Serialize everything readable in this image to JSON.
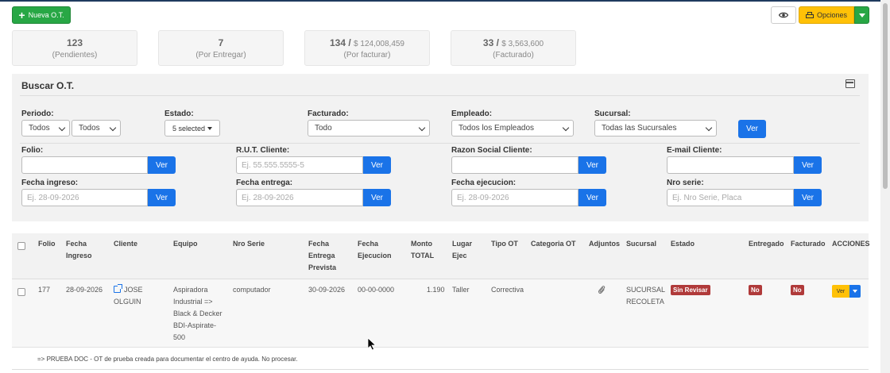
{
  "toolbar": {
    "new_label": "Nueva O.T.",
    "options_label": "Opciones"
  },
  "stats": [
    {
      "count": "123",
      "amount": "",
      "label": "(Pendientes)"
    },
    {
      "count": "7",
      "amount": "",
      "label": "(Por Entregar)"
    },
    {
      "count": "134 /",
      "amount": "$ 124,008,459",
      "label": "(Por facturar)"
    },
    {
      "count": "33 /",
      "amount": "$ 3,563,600",
      "label": "(Facturado)"
    }
  ],
  "search": {
    "title": "Buscar O.T.",
    "periodo_label": "Periodo:",
    "periodo_1": "Todos",
    "periodo_2": "Todos",
    "estado_label": "Estado:",
    "estado_value": "5 selected",
    "facturado_label": "Facturado:",
    "facturado_value": "Todo",
    "empleado_label": "Empleado:",
    "empleado_value": "Todos los Empleados",
    "sucursal_label": "Sucursal:",
    "sucursal_value": "Todas las Sucursales",
    "ver_label": "Ver",
    "folio_label": "Folio:",
    "rut_label": "R.U.T. Cliente:",
    "rut_placeholder": "Ej. 55.555.5555-5",
    "razon_label": "Razon Social Cliente:",
    "email_label": "E-mail Cliente:",
    "fecha_ingreso_label": "Fecha ingreso:",
    "fecha_ingreso_placeholder": "Ej. 28-09-2026",
    "fecha_entrega_label": "Fecha entrega:",
    "fecha_entrega_placeholder": "Ej. 28-09-2026",
    "fecha_ejecucion_label": "Fecha ejecucion:",
    "fecha_ejecucion_placeholder": "Ej. 28-09-2026",
    "nro_serie_label": "Nro serie:",
    "nro_serie_placeholder": "Ej. Nro Serie, Placa"
  },
  "table": {
    "headers": {
      "folio": "Folio",
      "fecha_ingreso": [
        "Fecha",
        "Ingreso"
      ],
      "cliente": "Cliente",
      "equipo": "Equipo",
      "nro_serie": "Nro Serie",
      "fecha_entrega": [
        "Fecha",
        "Entrega",
        "Prevista"
      ],
      "fecha_ejecucion": [
        "Fecha",
        "Ejecucion"
      ],
      "monto": [
        "Monto",
        "TOTAL"
      ],
      "lugar": [
        "Lugar",
        "Ejec"
      ],
      "tipo": "Tipo OT",
      "categoria": "Categoria OT",
      "adjuntos": "Adjuntos",
      "sucursal": "Sucursal",
      "estado": "Estado",
      "entregado": "Entregado",
      "facturado": "Facturado",
      "acciones": "ACCIONES"
    },
    "row": {
      "folio": "177",
      "fecha_ingreso": "28-09-2026",
      "cliente": [
        "JOSE",
        "OLGUIN"
      ],
      "equipo": [
        "Aspiradora",
        "Industrial =>",
        "Black & Decker",
        "BDI-Aspirate-",
        "500"
      ],
      "nro_serie": "computador",
      "fecha_entrega": "30-09-2026",
      "fecha_ejecucion": "00-00-0000",
      "monto": "1.190",
      "lugar": "Taller",
      "tipo": "Correctiva",
      "sucursal": [
        "SUCURSAL",
        "RECOLETA"
      ],
      "estado": "Sin Revisar",
      "entregado": "No",
      "facturado": "No",
      "ver_label": "Ver"
    },
    "note": "=> PRUEBA DOC - OT de prueba creada para documentar el centro de ayuda. No procesar."
  }
}
